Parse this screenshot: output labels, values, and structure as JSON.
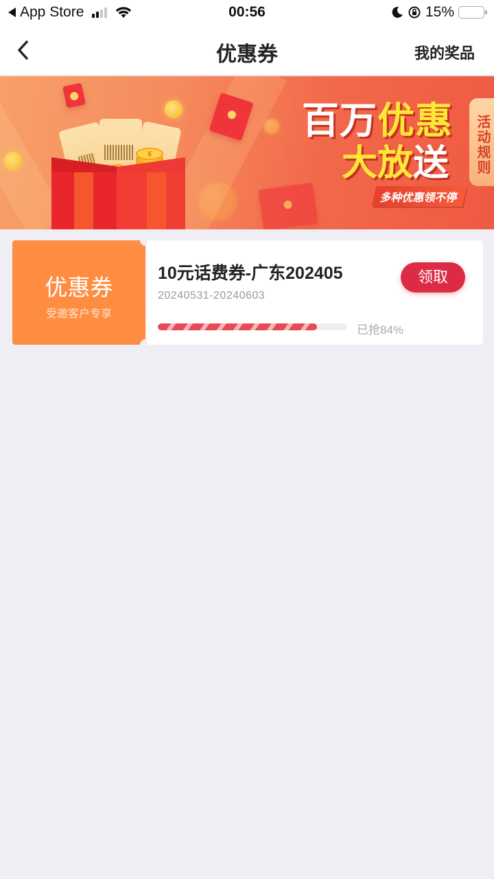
{
  "status_bar": {
    "back_app": "App Store",
    "time": "00:56",
    "battery_percent": "15%",
    "battery_level": 0.15,
    "signal_bars_active": 2,
    "signal_bars_total": 4
  },
  "nav": {
    "title": "优惠券",
    "right_link": "我的奖品",
    "back_icon": "chevron-left-icon"
  },
  "banner": {
    "headline_white_1": "百万",
    "headline_yellow_1": "优惠",
    "headline_yellow_2": "大放",
    "headline_white_2": "送",
    "tagline": "多种优惠领不停",
    "rules_tab": "活动规则",
    "coin_symbol": "¥"
  },
  "coupons": [
    {
      "type_label": "优惠券",
      "sub_label": "受邀客户专享",
      "title": "10元话费券-广东202405",
      "date_range": "20240531-20240603",
      "claimed_text": "已抢84%",
      "claimed_fraction": 0.84,
      "button_label": "领取",
      "accent_color": "#fe8d42",
      "button_color": "#dd2a45"
    }
  ]
}
